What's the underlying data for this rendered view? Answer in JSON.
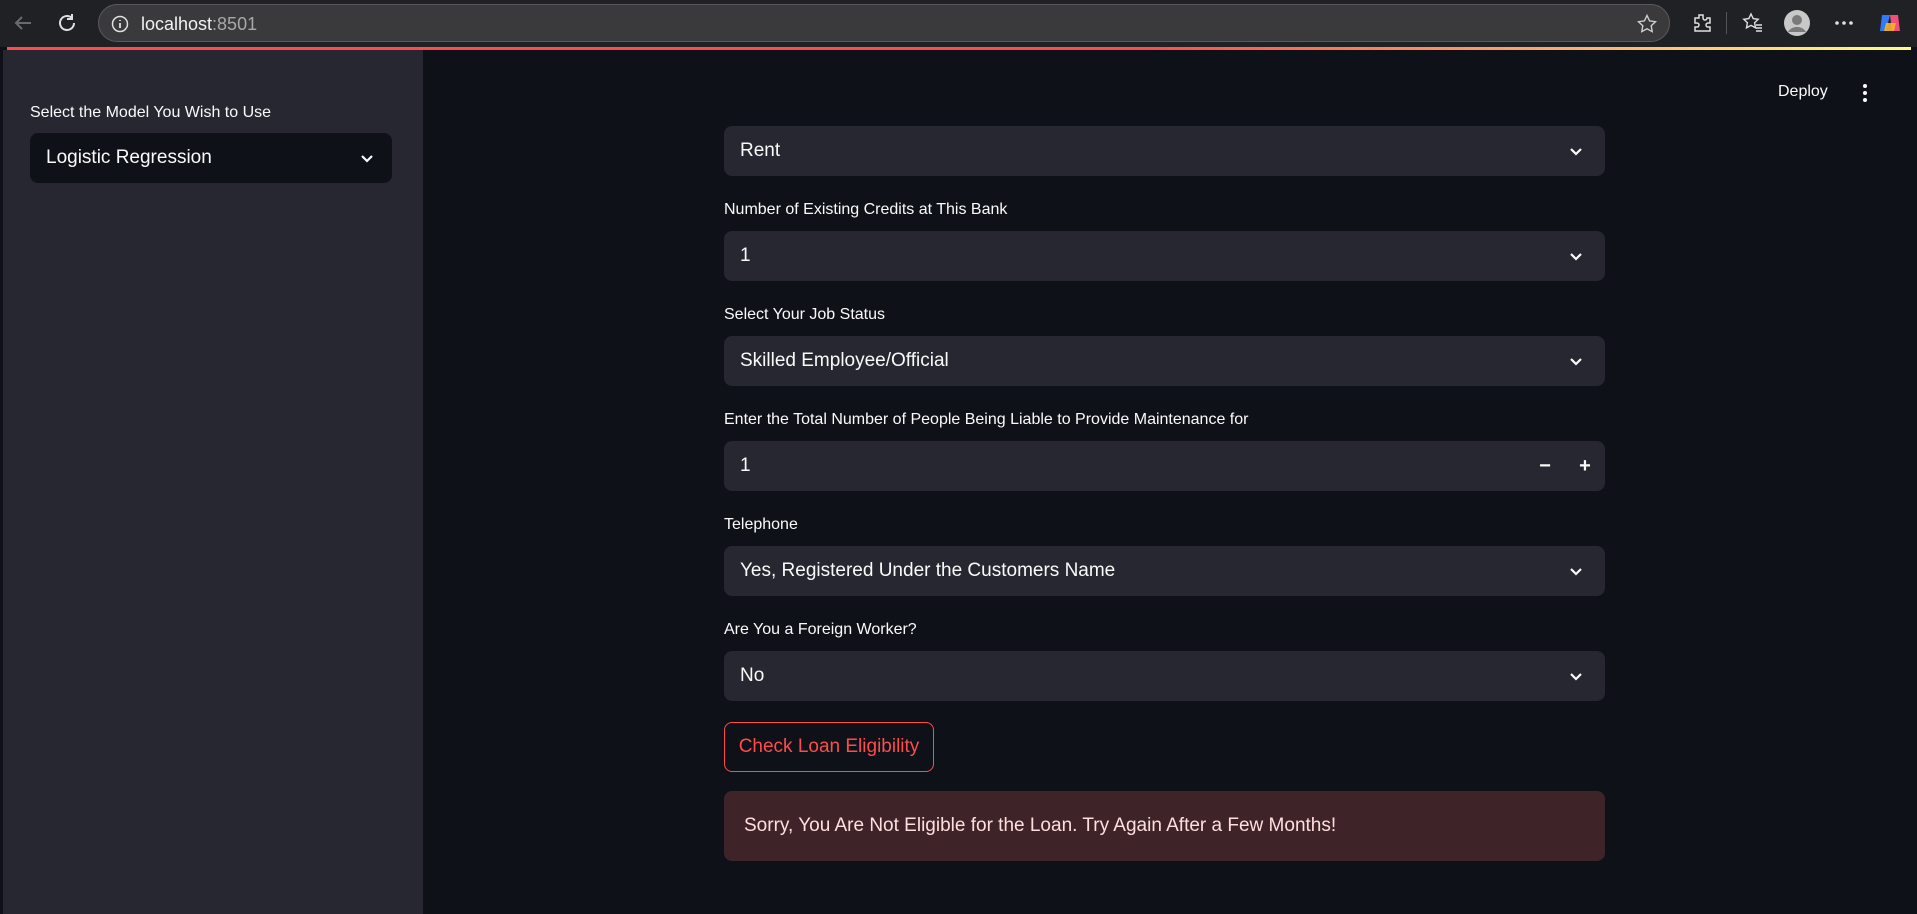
{
  "browser": {
    "url_host": "localhost",
    "url_port": ":8501",
    "icons": [
      "back-icon",
      "reload-icon",
      "site-info-icon",
      "favorite-star-icon",
      "extensions-icon",
      "favorites-icon",
      "profile-icon",
      "more-icon",
      "copilot-icon"
    ]
  },
  "header": {
    "deploy_label": "Deploy"
  },
  "sidebar": {
    "model_label": "Select the Model You Wish to Use",
    "model_value": "Logistic Regression"
  },
  "form": {
    "housing_value": "Rent",
    "credits_label": "Number of Existing Credits at This Bank",
    "credits_value": "1",
    "job_label": "Select Your Job Status",
    "job_value": "Skilled Employee/Official",
    "liable_label": "Enter the Total Number of People Being Liable to Provide Maintenance for",
    "liable_value": "1",
    "decrement_symbol": "−",
    "increment_symbol": "+",
    "telephone_label": "Telephone",
    "telephone_value": "Yes, Registered Under the Customers Name",
    "foreign_label": "Are You a Foreign Worker?",
    "foreign_value": "No",
    "submit_label": "Check Loan Eligibility"
  },
  "result": {
    "message": "Sorry, You Are Not Eligible for the Loan. Try Again After a Few Months!"
  },
  "colors": {
    "primary": "#ff4b4b",
    "background": "#0e1117",
    "sidebar_bg": "#262730",
    "error_bg": "#3e2428"
  }
}
